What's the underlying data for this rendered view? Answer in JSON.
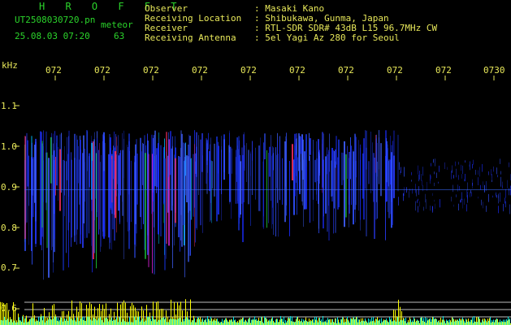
{
  "header": {
    "title": "H R O F F T",
    "filename": "UT2508030720.pn",
    "kind": "meteor",
    "datetime": "25.08.03 07:20",
    "count": "63",
    "info": [
      {
        "key": "Observer",
        "value": ": Masaki Kano"
      },
      {
        "key": "Receiving Location",
        "value": ": Shibukawa, Gunma, Japan"
      },
      {
        "key": "Receiver",
        "value": ": RTL-SDR SDR# 43dB L15 96.7MHz CW"
      },
      {
        "key": "Receiving Antenna",
        "value": ": 5el Yagi Az 280 for Seoul"
      }
    ]
  },
  "axis": {
    "y_unit": "kHz",
    "x_ticks": [
      "072",
      "072",
      "072",
      "072",
      "072",
      "072",
      "072",
      "072",
      "072",
      "0730"
    ],
    "y_ticks": [
      "1.1",
      "1.0",
      "0.9",
      "0.8",
      "0.7",
      "0.6"
    ]
  },
  "colors": {
    "label_green": "#2bd42b",
    "label_yellow": "#e8e85a",
    "signal_blue": "#2a3cff",
    "trace_yellow": "#ffff00",
    "trace_cyan": "#00e5e5"
  }
}
